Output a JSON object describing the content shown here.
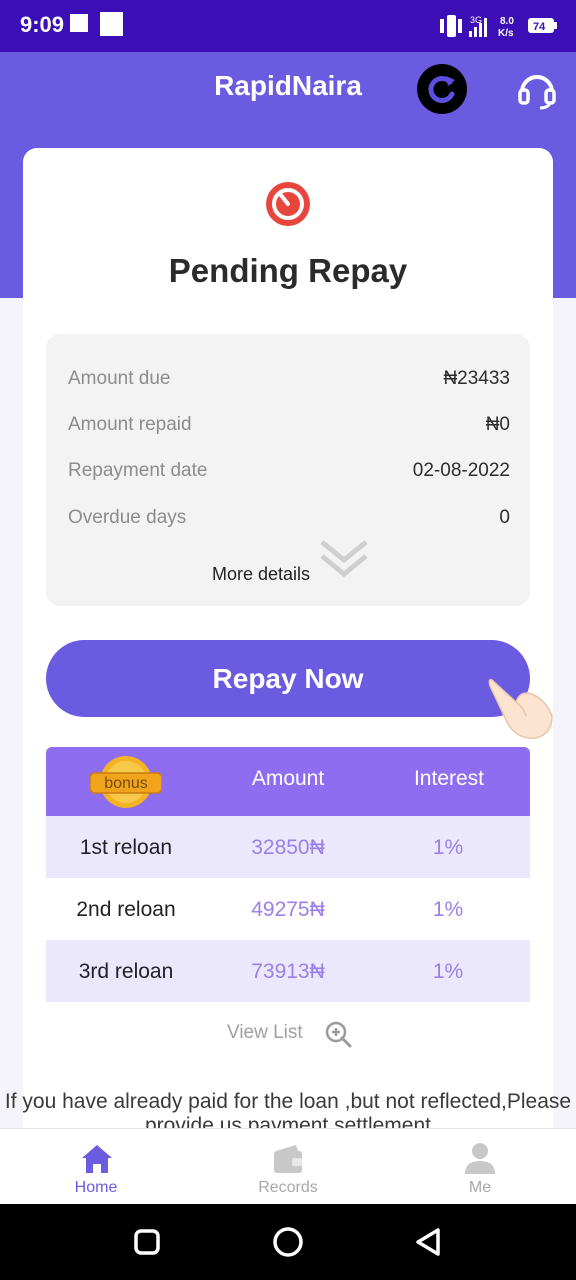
{
  "status_bar": {
    "time": "9:09",
    "network_speed_value": "8.0",
    "network_speed_unit": "K/s",
    "battery": "74",
    "signal": "3G"
  },
  "header": {
    "app_title": "RapidNaira"
  },
  "card": {
    "title": "Pending Repay",
    "rows": [
      {
        "label": "Amount due",
        "value": "₦23433"
      },
      {
        "label": "Amount repaid",
        "value": "₦0"
      },
      {
        "label": "Repayment date",
        "value": "02-08-2022"
      },
      {
        "label": "Overdue days",
        "value": "0"
      }
    ],
    "more_details": "More details"
  },
  "repay_button": {
    "label": "Repay Now"
  },
  "reload_table": {
    "badge": "bonus",
    "headers": {
      "amount": "Amount",
      "interest": "Interest"
    },
    "rows": [
      {
        "name": "1st reloan",
        "amount": "32850₦",
        "interest": "1%"
      },
      {
        "name": "2nd reloan",
        "amount": "49275₦",
        "interest": "1%"
      },
      {
        "name": "3rd reloan",
        "amount": "73913₦",
        "interest": "1%"
      }
    ]
  },
  "view_list": {
    "label": "View List"
  },
  "notice": "If you have already paid for the loan ,but not reflected,Please provide us payment settlement",
  "bottom_nav": [
    {
      "label": "Home",
      "icon": "home-icon",
      "active": true
    },
    {
      "label": "Records",
      "icon": "wallet-icon",
      "active": false
    },
    {
      "label": "Me",
      "icon": "person-icon",
      "active": false
    }
  ],
  "colors": {
    "accent": "#6b5be0",
    "status_bar": "#3c0fb6",
    "table_header": "#8f6df0",
    "value_text": "#9a80e8",
    "timer_red": "#e8453c"
  }
}
